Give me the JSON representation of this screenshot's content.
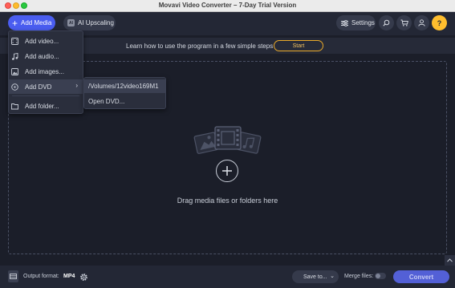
{
  "window": {
    "title": "Movavi Video Converter – 7-Day Trial Version"
  },
  "toolbar": {
    "add_media_label": "Add Media",
    "ai_upscaling_label": "AI Upscaling",
    "ai_icon_text": "AI",
    "settings_label": "Settings",
    "icons": [
      "search-icon",
      "cart-icon",
      "account-icon",
      "help-icon"
    ]
  },
  "banner": {
    "text": "Learn how to use the program in a few simple steps",
    "start_label": "Start"
  },
  "add_menu": {
    "items": [
      {
        "label": "Add video...",
        "icon": "add-video-icon"
      },
      {
        "label": "Add audio...",
        "icon": "add-audio-icon"
      },
      {
        "label": "Add images...",
        "icon": "add-images-icon"
      },
      {
        "label": "Add DVD",
        "icon": "add-dvd-icon"
      },
      {
        "label": "Add folder...",
        "icon": "add-folder-icon"
      }
    ],
    "highlighted": "Add DVD"
  },
  "dvd_submenu": {
    "items": [
      {
        "label": "/Volumes/12video169M1"
      },
      {
        "label": "Open DVD..."
      }
    ]
  },
  "drop_zone": {
    "text": "Drag media files or folders here"
  },
  "bottom_bar": {
    "output_format_label": "Output format:",
    "output_format_value": "MP4",
    "save_to_label": "Save to...",
    "merge_files_label": "Merge files:",
    "merge_files_on": false,
    "convert_label": "Convert"
  },
  "colors": {
    "accent": "#4a5df0",
    "start_border": "#e8a92a",
    "help": "#ffbe2e",
    "background": "#1b1e29"
  }
}
